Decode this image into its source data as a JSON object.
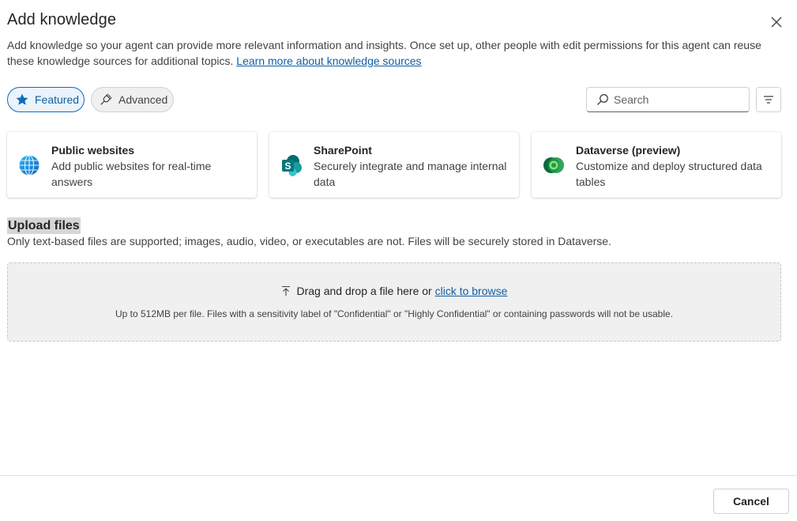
{
  "dialog": {
    "title": "Add knowledge",
    "description": "Add knowledge so your agent can provide more relevant information and insights. Once set up, other people with edit permissions for this agent can reuse these knowledge sources for additional topics.",
    "learn_more_link": "Learn more about knowledge sources",
    "close_icon": "close-icon"
  },
  "filters": {
    "featured_label": "Featured",
    "featured_icon": "star-icon",
    "advanced_label": "Advanced",
    "advanced_icon": "plug-icon",
    "search_placeholder": "Search",
    "filter_icon": "filter-icon"
  },
  "cards": [
    {
      "title": "Public websites",
      "description": "Add public websites for real-time answers",
      "icon": "globe-icon"
    },
    {
      "title": "SharePoint",
      "description": "Securely integrate and manage internal data",
      "icon": "sharepoint-icon"
    },
    {
      "title": "Dataverse (preview)",
      "description": "Customize and deploy structured data tables",
      "icon": "dataverse-icon"
    }
  ],
  "upload": {
    "title": "Upload files",
    "note": "Only text-based files are supported; images, audio, video, or executables are not. Files will be securely stored in Dataverse.",
    "drop_text": "Drag and drop a file here or",
    "browse_link": "click to browse",
    "hint": "Up to 512MB per file. Files with a sensitivity label of \"Confidential\" or \"Highly Confidential\" or containing passwords will not be usable."
  },
  "footer": {
    "cancel_label": "Cancel"
  },
  "colors": {
    "accent": "#0f6cbd",
    "link": "#115ea3",
    "dropzone_bg": "#f0f0f0"
  }
}
